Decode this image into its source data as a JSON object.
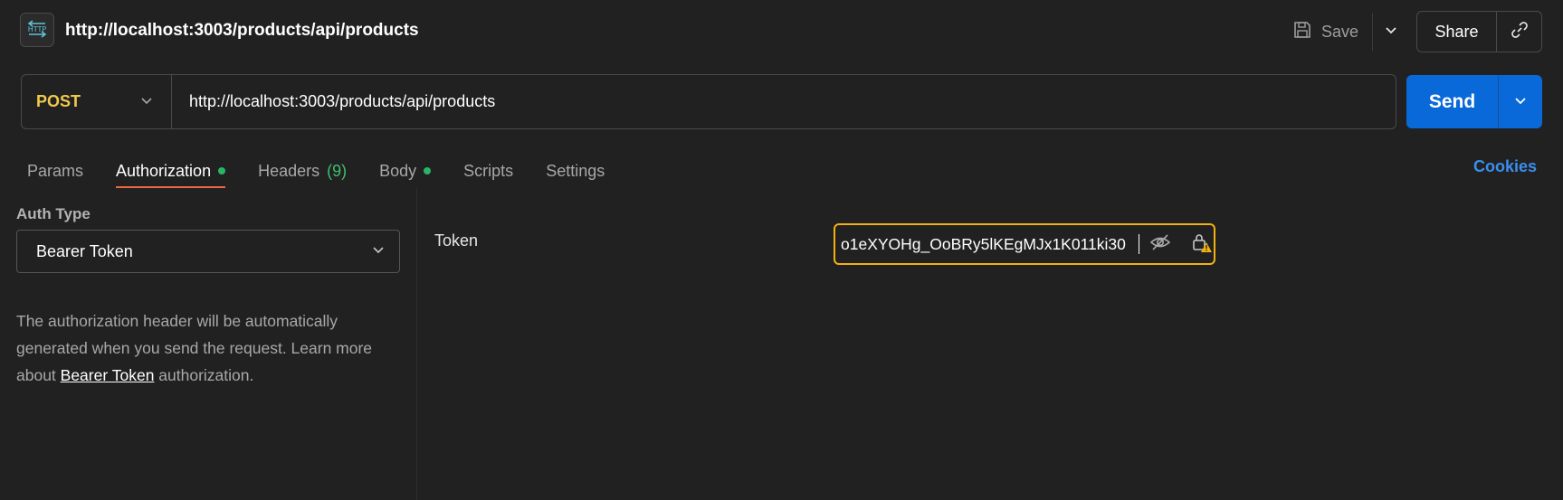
{
  "header": {
    "icon_text": "HTTP",
    "title": "http://localhost:3003/products/api/products",
    "save_label": "Save",
    "share_label": "Share"
  },
  "request": {
    "method": "POST",
    "url": "http://localhost:3003/products/api/products",
    "send_label": "Send"
  },
  "tabs": [
    {
      "label": "Params"
    },
    {
      "label": "Authorization",
      "dot": true
    },
    {
      "label": "Headers",
      "count": "(9)"
    },
    {
      "label": "Body",
      "dot": true
    },
    {
      "label": "Scripts"
    },
    {
      "label": "Settings"
    }
  ],
  "cookies_label": "Cookies",
  "auth": {
    "type_label": "Auth Type",
    "type_value": "Bearer Token",
    "desc_before": "The authorization header will be automatically generated when you send the request. Learn more about ",
    "desc_link": "Bearer Token",
    "desc_after": " authorization."
  },
  "token": {
    "label": "Token",
    "value": "o1eXYOHg_OoBRy5lKEgMJx1K011ki30"
  },
  "colors": {
    "method": "#f0c94c",
    "send": "#0a69d9",
    "active_tab_underline": "#e8683f",
    "dot": "#2ab566",
    "cookies": "#3a8ef0",
    "token_border": "#f2b10f"
  }
}
